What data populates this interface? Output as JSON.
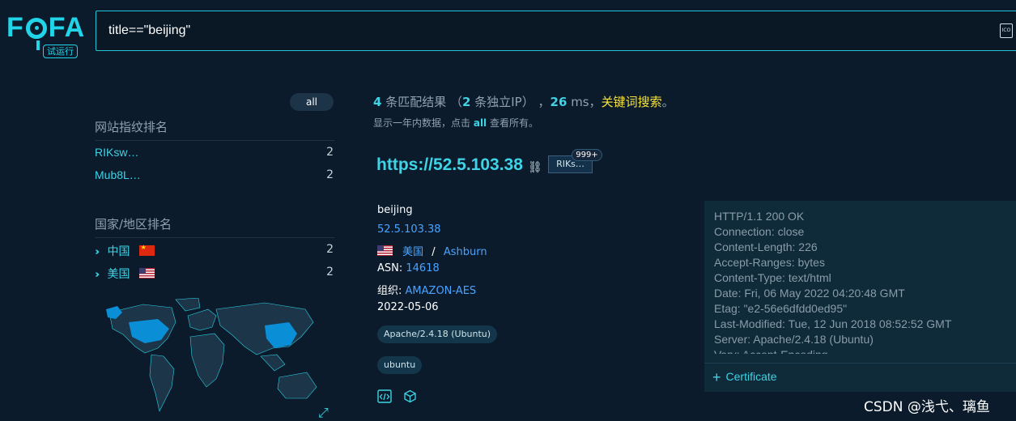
{
  "logo": {
    "text_f1": "F",
    "text_rest": "FA",
    "trial": "试运行"
  },
  "search": {
    "query": "title==\"beijing\"",
    "icon": "icon-toggle"
  },
  "filter": {
    "all_label": "all"
  },
  "fingerprint": {
    "title": "网站指纹排名",
    "items": [
      {
        "name": "RIKsw…",
        "count": "2"
      },
      {
        "name": "Mub8L…",
        "count": "2"
      }
    ]
  },
  "country": {
    "title": "国家/地区排名",
    "items": [
      {
        "name": "中国",
        "flag": "cn",
        "count": "2"
      },
      {
        "name": "美国",
        "flag": "us",
        "count": "2"
      }
    ]
  },
  "summary": {
    "count": "4",
    "matches_label": "条匹配结果",
    "paren_open": "（",
    "ip_count": "2",
    "ip_label": "条独立IP）",
    "sep1": "，",
    "ms": "26",
    "ms_unit": "ms",
    "sep2": "，",
    "keyword": "关键词搜索",
    "end": "。",
    "sub_before": "显示一年内数据，点击",
    "sub_all": "all",
    "sub_after": "查看所有。"
  },
  "result": {
    "url": "https://52.5.103.38",
    "tag": "RIKs…",
    "badge": "999+",
    "title": "beijing",
    "ip": "52.5.103.38",
    "country": "美国",
    "slash": "/",
    "city": "Ashburn",
    "asn_label": "ASN:",
    "asn": "14618",
    "org_label": "组织:",
    "org": "AMAZON-AES",
    "date": "2022-05-06",
    "chips": [
      "Apache/2.4.18 (Ubuntu)",
      "ubuntu"
    ]
  },
  "headers": {
    "text": "HTTP/1.1 200 OK\nConnection: close\nContent-Length: 226\nAccept-Ranges: bytes\nContent-Type: text/html\nDate: Fri, 06 May 2022 04:20:48 GMT\nEtag: \"e2-56e6dfdd0ed95\"\nLast-Modified: Tue, 12 Jun 2018 08:52:52 GMT\nServer: Apache/2.4.18 (Ubuntu)\nVary: Accept-Encoding",
    "cert_plus": "+",
    "cert_label": "Certificate"
  },
  "watermark": "CSDN @浅弋、璃鱼"
}
